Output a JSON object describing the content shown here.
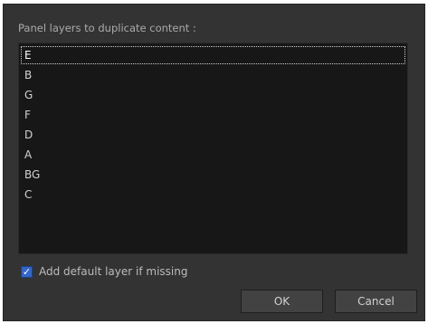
{
  "dialog": {
    "prompt": "Panel layers to duplicate content :",
    "layers": [
      "E",
      "B",
      "G",
      "F",
      "D",
      "A",
      "BG",
      "C"
    ],
    "selected_layer": "E",
    "add_default_checkbox": {
      "checked": true,
      "label": "Add default layer if missing"
    },
    "ok_label": "OK",
    "cancel_label": "Cancel"
  },
  "colors": {
    "dialog_background": "#333333",
    "list_background": "#171717",
    "checkbox_accent": "#3466c8"
  },
  "icons": {
    "checkbox_mark": "check-icon"
  }
}
